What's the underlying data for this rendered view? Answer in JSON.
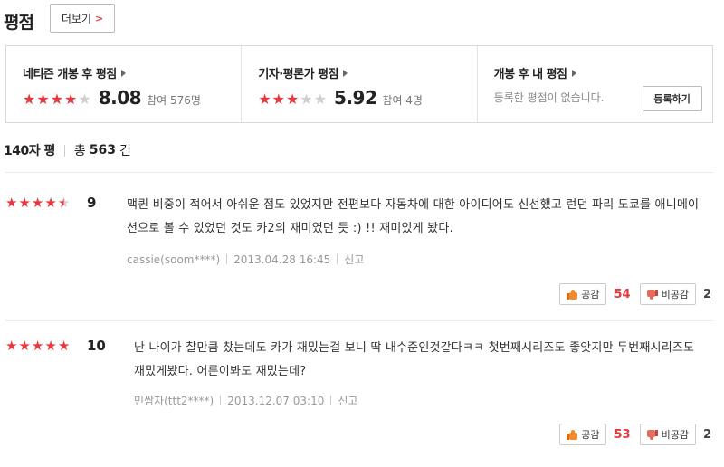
{
  "header": {
    "title": "평점",
    "more_label": "더보기",
    "more_chevron": ">"
  },
  "summary": {
    "netizen": {
      "label": "네티즌 개봉 후 평점",
      "stars": 4,
      "score": "8.08",
      "participants": "참여 576명"
    },
    "critic": {
      "label": "기자·평론가 평점",
      "stars": 3,
      "score": "5.92",
      "participants": "참여 4명"
    },
    "mine": {
      "label": "개봉 후 내 평점",
      "empty_text": "등록한 평점이 없습니다.",
      "register_label": "등록하기"
    }
  },
  "count_line": {
    "tab": "140자 평",
    "total_prefix": "총",
    "total": "563",
    "total_suffix": "건"
  },
  "reviews": [
    {
      "stars": 4.5,
      "score": "9",
      "text": "맥퀸 비중이 적어서 아쉬운 점도 있었지만 전편보다 자동차에 대한 아이디어도 신선했고 런던 파리 도쿄를 애니메이션으로 볼 수 있었던 것도 카2의 재미였던 듯 :) !! 재미있게 봤다.",
      "author": "cassie(soom****)",
      "date": "2013.04.28 16:45",
      "report": "신고",
      "like_label": "공감",
      "like_count": "54",
      "dislike_label": "비공감",
      "dislike_count": "2"
    },
    {
      "stars": 5,
      "score": "10",
      "text": "난 나이가 찰만큼 찼는데도 카가 재밌는걸 보니 딱 내수준인것같다ㅋㅋ 첫번째시리즈도 좋앗지만 두번째시리즈도 재밌게봤다. 어른이봐도 재밌는데?",
      "author": "민쌈자(ttt2****)",
      "date": "2013.12.07 03:10",
      "report": "신고",
      "like_label": "공감",
      "like_count": "53",
      "dislike_label": "비공감",
      "dislike_count": "2"
    }
  ],
  "colors": {
    "accent_red": "#e8383d",
    "star_off": "#cfcfcf",
    "thumb_up": "#f08a2c",
    "thumb_down": "#e46a5a"
  },
  "icons": {
    "star": "star-icon",
    "half_star": "half-star-icon",
    "chevron": "chevron-right-icon",
    "thumb_up": "thumb-up-icon",
    "thumb_down": "thumb-down-icon"
  }
}
